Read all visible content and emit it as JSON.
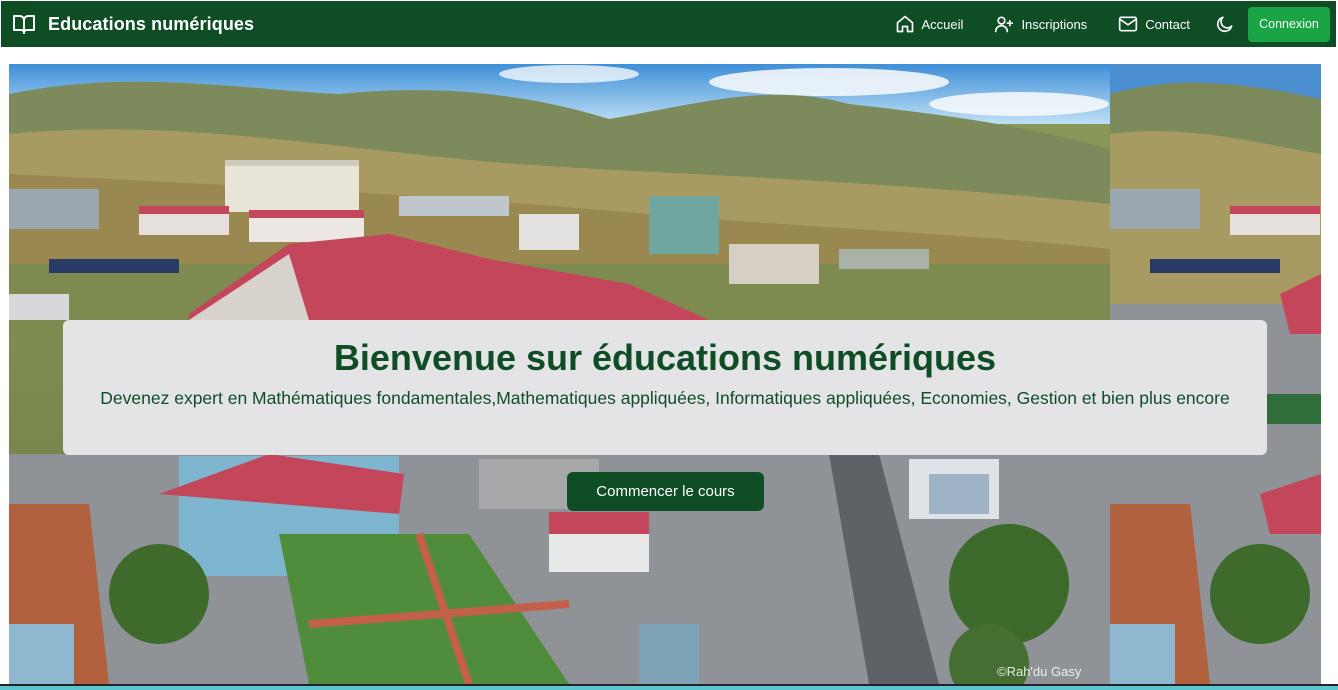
{
  "header": {
    "brand_icon": "open-book-icon",
    "brand_title": "Educations numériques",
    "nav": [
      {
        "label": "Accueil",
        "icon": "home-icon"
      },
      {
        "label": "Inscriptions",
        "icon": "user-plus-icon"
      },
      {
        "label": "Contact",
        "icon": "mail-icon"
      }
    ],
    "theme_toggle_icon": "moon-icon",
    "login_label": "Connexion"
  },
  "hero": {
    "image_subject": "aerial-town-landscape-photo",
    "title": "Bienvenue sur éducations numériques",
    "subtitle": "Devenez expert en Mathématiques fondamentales,Mathematiques appliquées, Informatiques appliquées, Economies, Gestion et bien plus encore",
    "cta_label": "Commencer le cours",
    "watermark": "©Rah'du Gasy"
  },
  "colors": {
    "navbar": "#0f4d25",
    "login_button": "#19a546",
    "title_text": "#0f4d25",
    "card_background": "#e4e4e7"
  }
}
